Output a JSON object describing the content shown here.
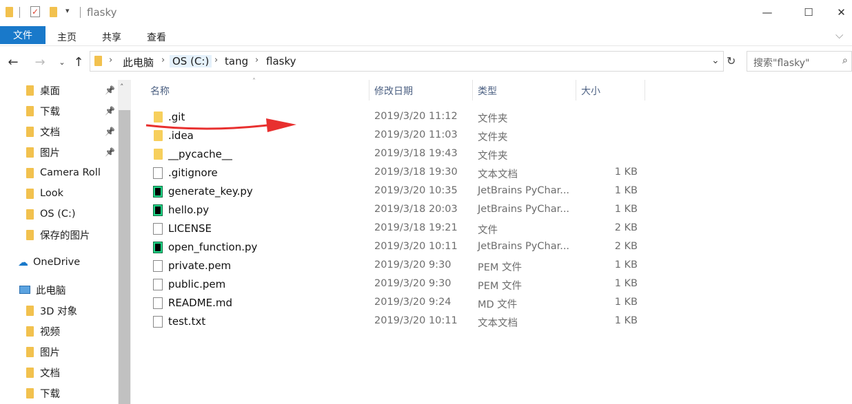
{
  "window": {
    "title": "flasky",
    "minimize_glyph": "—",
    "maximize_glyph": "☐",
    "close_glyph": "✕"
  },
  "ribbon": {
    "file_tab": "文件",
    "tabs": [
      "主页",
      "共享",
      "查看"
    ],
    "expand_glyph": "⌵"
  },
  "address": {
    "crumbs": [
      "此电脑",
      "OS (C:)",
      "tang",
      "flasky"
    ],
    "search_placeholder": "搜索\"flasky\""
  },
  "nav": {
    "quick_access": [
      {
        "label": "桌面",
        "pinned": true
      },
      {
        "label": "下载",
        "pinned": true
      },
      {
        "label": "文档",
        "pinned": true
      },
      {
        "label": "图片",
        "pinned": true
      },
      {
        "label": "Camera Roll",
        "pinned": false
      },
      {
        "label": "Look",
        "pinned": false
      },
      {
        "label": "OS (C:)",
        "pinned": false
      },
      {
        "label": "保存的图片",
        "pinned": false
      }
    ],
    "onedrive": "OneDrive",
    "this_pc": "此电脑",
    "this_pc_items": [
      "3D 对象",
      "视频",
      "图片",
      "文档",
      "下载"
    ]
  },
  "columns": {
    "name": "名称",
    "date": "修改日期",
    "type": "类型",
    "size": "大小"
  },
  "files": [
    {
      "name": ".git",
      "date": "2019/3/20 11:12",
      "type": "文件夹",
      "size": "",
      "icon": "folder-icon"
    },
    {
      "name": ".idea",
      "date": "2019/3/20 11:03",
      "type": "文件夹",
      "size": "",
      "icon": "folder-icon"
    },
    {
      "name": "__pycache__",
      "date": "2019/3/18 19:43",
      "type": "文件夹",
      "size": "",
      "icon": "folder-icon"
    },
    {
      "name": ".gitignore",
      "date": "2019/3/18 19:30",
      "type": "文本文档",
      "size": "1 KB",
      "icon": "text-file-icon"
    },
    {
      "name": "generate_key.py",
      "date": "2019/3/20 10:35",
      "type": "JetBrains PyChar...",
      "size": "1 KB",
      "icon": "pycharm-file-icon"
    },
    {
      "name": "hello.py",
      "date": "2019/3/18 20:03",
      "type": "JetBrains PyChar...",
      "size": "1 KB",
      "icon": "pycharm-file-icon"
    },
    {
      "name": "LICENSE",
      "date": "2019/3/18 19:21",
      "type": "文件",
      "size": "2 KB",
      "icon": "blank-file-icon"
    },
    {
      "name": "open_function.py",
      "date": "2019/3/20 10:11",
      "type": "JetBrains PyChar...",
      "size": "2 KB",
      "icon": "pycharm-file-icon"
    },
    {
      "name": "private.pem",
      "date": "2019/3/20 9:30",
      "type": "PEM 文件",
      "size": "1 KB",
      "icon": "blank-file-icon"
    },
    {
      "name": "public.pem",
      "date": "2019/3/20 9:30",
      "type": "PEM 文件",
      "size": "1 KB",
      "icon": "blank-file-icon"
    },
    {
      "name": "README.md",
      "date": "2019/3/20 9:24",
      "type": "MD 文件",
      "size": "1 KB",
      "icon": "blank-file-icon"
    },
    {
      "name": "test.txt",
      "date": "2019/3/20 10:11",
      "type": "文本文档",
      "size": "1 KB",
      "icon": "text-file-icon"
    }
  ],
  "colors": {
    "accent": "#1979ca",
    "annotation_arrow": "#e8302f",
    "folder": "#f7cf5c"
  }
}
